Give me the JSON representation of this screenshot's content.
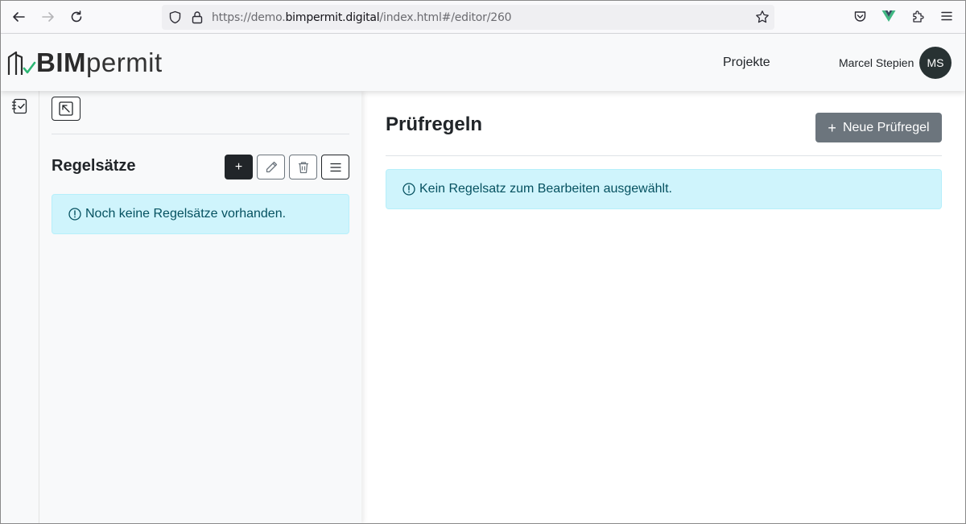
{
  "browser": {
    "url_prefix": "https://demo.",
    "url_host": "bimpermit.digital",
    "url_path": "/index.html#/editor/260",
    "icons": [
      "back-arrow-icon",
      "forward-arrow-icon",
      "reload-icon",
      "shield-icon",
      "lock-icon",
      "star-icon",
      "pocket-icon",
      "vue-devtools-icon",
      "extensions-icon",
      "menu-icon"
    ]
  },
  "header": {
    "logo_bold": "BIM",
    "logo_light": "permit",
    "nav_projects": "Projekte",
    "user_name": "Marcel Stepien",
    "user_initials": "MS"
  },
  "rail": {
    "icon": "checklist-icon"
  },
  "sidebar": {
    "title": "Regelsätze",
    "add_label": "+",
    "empty_message": "Noch keine Regelsätze vorhanden.",
    "tools": [
      "add-icon",
      "pencil-icon",
      "trash-icon",
      "list-icon"
    ]
  },
  "main": {
    "title": "Prüfregeln",
    "new_rule_plus": "+",
    "new_rule_label": "Neue Prüfregel",
    "empty_message": "Kein Regelsatz zum Bearbeiten ausgewählt."
  },
  "colors": {
    "accent_green": "#2bb673",
    "avatar_bg": "#283233",
    "alert_bg": "#cff4fc",
    "alert_text": "#055160",
    "secondary_btn": "#6c757d"
  }
}
